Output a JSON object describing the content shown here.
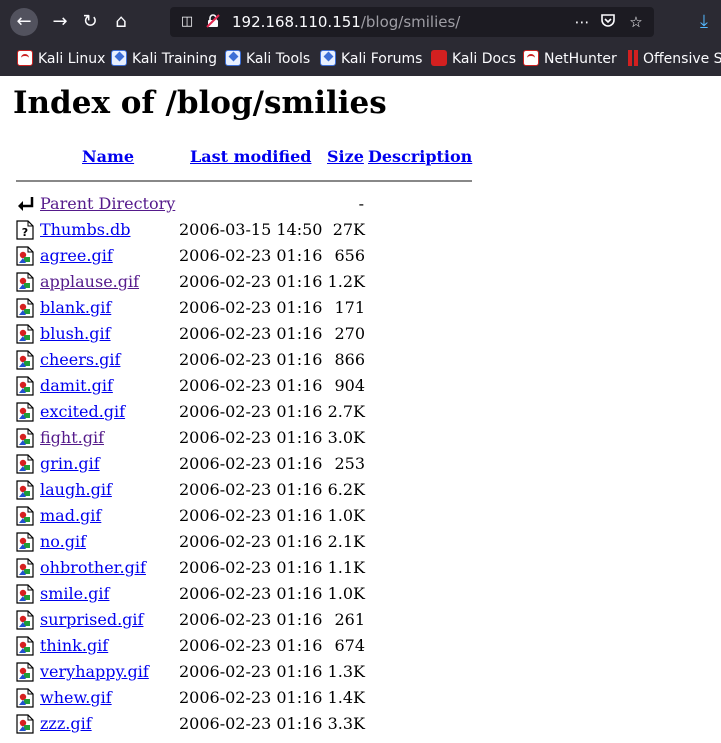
{
  "browser": {
    "url_host": "192.168.110.151",
    "url_path": "/blog/smilies/",
    "back_icon": "arrow-left-icon",
    "forward_icon": "arrow-right-icon",
    "reload_icon": "reload-icon",
    "home_icon": "home-icon",
    "more_icon": "ellipsis-icon",
    "pocket_icon": "pocket-icon",
    "bookmark_icon": "star-icon",
    "download_icon": "download-icon",
    "bookmarks": [
      {
        "label": "Kali Linux",
        "icon": "kali"
      },
      {
        "label": "Kali Training",
        "icon": "blue"
      },
      {
        "label": "Kali Tools",
        "icon": "blue"
      },
      {
        "label": "Kali Forums",
        "icon": "blue"
      },
      {
        "label": "Kali Docs",
        "icon": "red"
      },
      {
        "label": "NetHunter",
        "icon": "kali"
      },
      {
        "label": "Offensive Security",
        "icon": "offsec"
      }
    ]
  },
  "page": {
    "title": "Index of /blog/smilies",
    "columns": {
      "name": "Name",
      "last_modified": "Last modified",
      "size": "Size",
      "description": "Description"
    },
    "parent": {
      "name": "Parent Directory",
      "size": "-"
    },
    "files": [
      {
        "name": "Thumbs.db",
        "date": "2006-03-15 14:50",
        "size": "27K",
        "type": "unknown",
        "visited": false
      },
      {
        "name": "agree.gif",
        "date": "2006-02-23 01:16",
        "size": "656",
        "type": "image",
        "visited": false
      },
      {
        "name": "applause.gif",
        "date": "2006-02-23 01:16",
        "size": "1.2K",
        "type": "image",
        "visited": true
      },
      {
        "name": "blank.gif",
        "date": "2006-02-23 01:16",
        "size": "171",
        "type": "image",
        "visited": false
      },
      {
        "name": "blush.gif",
        "date": "2006-02-23 01:16",
        "size": "270",
        "type": "image",
        "visited": false
      },
      {
        "name": "cheers.gif",
        "date": "2006-02-23 01:16",
        "size": "866",
        "type": "image",
        "visited": false
      },
      {
        "name": "damit.gif",
        "date": "2006-02-23 01:16",
        "size": "904",
        "type": "image",
        "visited": false
      },
      {
        "name": "excited.gif",
        "date": "2006-02-23 01:16",
        "size": "2.7K",
        "type": "image",
        "visited": false
      },
      {
        "name": "fight.gif",
        "date": "2006-02-23 01:16",
        "size": "3.0K",
        "type": "image",
        "visited": true
      },
      {
        "name": "grin.gif",
        "date": "2006-02-23 01:16",
        "size": "253",
        "type": "image",
        "visited": false
      },
      {
        "name": "laugh.gif",
        "date": "2006-02-23 01:16",
        "size": "6.2K",
        "type": "image",
        "visited": false
      },
      {
        "name": "mad.gif",
        "date": "2006-02-23 01:16",
        "size": "1.0K",
        "type": "image",
        "visited": false
      },
      {
        "name": "no.gif",
        "date": "2006-02-23 01:16",
        "size": "2.1K",
        "type": "image",
        "visited": false
      },
      {
        "name": "ohbrother.gif",
        "date": "2006-02-23 01:16",
        "size": "1.1K",
        "type": "image",
        "visited": false
      },
      {
        "name": "smile.gif",
        "date": "2006-02-23 01:16",
        "size": "1.0K",
        "type": "image",
        "visited": false
      },
      {
        "name": "surprised.gif",
        "date": "2006-02-23 01:16",
        "size": "261",
        "type": "image",
        "visited": false
      },
      {
        "name": "think.gif",
        "date": "2006-02-23 01:16",
        "size": "674",
        "type": "image",
        "visited": false
      },
      {
        "name": "veryhappy.gif",
        "date": "2006-02-23 01:16",
        "size": "1.3K",
        "type": "image",
        "visited": false
      },
      {
        "name": "whew.gif",
        "date": "2006-02-23 01:16",
        "size": "1.4K",
        "type": "image",
        "visited": false
      },
      {
        "name": "zzz.gif",
        "date": "2006-02-23 01:16",
        "size": "3.3K",
        "type": "image",
        "visited": false
      }
    ]
  },
  "colors": {
    "chrome_bg": "#2b2a33",
    "urlbar_bg": "#1c1b22",
    "link": "#0000ee",
    "visited": "#551a8b",
    "download_accent": "#54b8ff"
  }
}
